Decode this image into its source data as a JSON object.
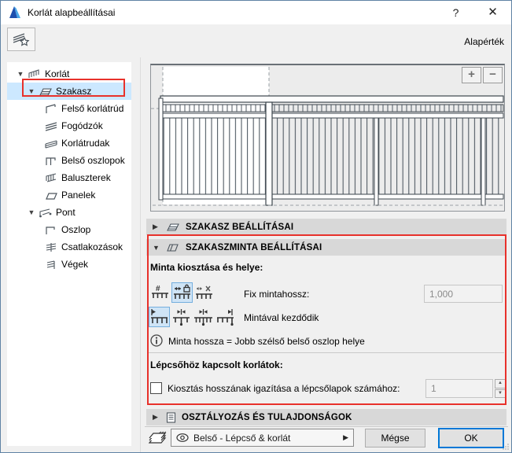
{
  "window": {
    "title": "Korlát alapbeállításai",
    "help_label": "?",
    "close_label": "✕",
    "default_label": "Alapérték"
  },
  "tree": {
    "items": [
      {
        "label": "Korlát",
        "level": 0,
        "expanded": true
      },
      {
        "label": "Szakasz",
        "level": 1,
        "expanded": true,
        "selected": true,
        "annotated": true
      },
      {
        "label": "Felső korlátrúd",
        "level": 2
      },
      {
        "label": "Fogódzók",
        "level": 2
      },
      {
        "label": "Korlátrudak",
        "level": 2
      },
      {
        "label": "Belső oszlopok",
        "level": 2
      },
      {
        "label": "Baluszterek",
        "level": 2
      },
      {
        "label": "Panelek",
        "level": 2
      },
      {
        "label": "Pont",
        "level": 1,
        "expanded": true
      },
      {
        "label": "Oszlop",
        "level": 2
      },
      {
        "label": "Csatlakozások",
        "level": 2
      },
      {
        "label": "Végek",
        "level": 2
      }
    ]
  },
  "preview": {
    "zoom_in": "+",
    "zoom_out": "−"
  },
  "sections": {
    "szakasz": {
      "title": "SZAKASZ BEÁLLÍTÁSAI",
      "collapsed_arrow": "▶"
    },
    "szakaszminta": {
      "title": "SZAKASZMINTA BEÁLLÍTÁSAI",
      "expanded_arrow": "▼"
    },
    "osztalyozas": {
      "title": "OSZTÁLYOZÁS ÉS TULAJDONSÁGOK",
      "collapsed_arrow": "▶"
    }
  },
  "pattern": {
    "heading": "Minta kiosztása és helye:",
    "fix_length_label": "Fix mintahossz:",
    "fix_length_value": "1,000",
    "start_label": "Mintával kezdődik",
    "info_text": "Minta hossza = Jobb szélső belső oszlop helye",
    "stairs_heading": "Lépcsőhöz kapcsolt korlátok:",
    "checkbox_label": "Kiosztás hosszának igazítása a lépcsőlapok számához:",
    "spin_value": "1"
  },
  "footer": {
    "layer_name": "Belső - Lépcső & korlát",
    "cancel_label": "Mégse",
    "ok_label": "OK"
  },
  "colors": {
    "annotation_red": "#e8312b",
    "selection_blue": "#cce8ff",
    "icon_selected_bg": "#cfe4f6",
    "ok_border": "#0078d7"
  }
}
